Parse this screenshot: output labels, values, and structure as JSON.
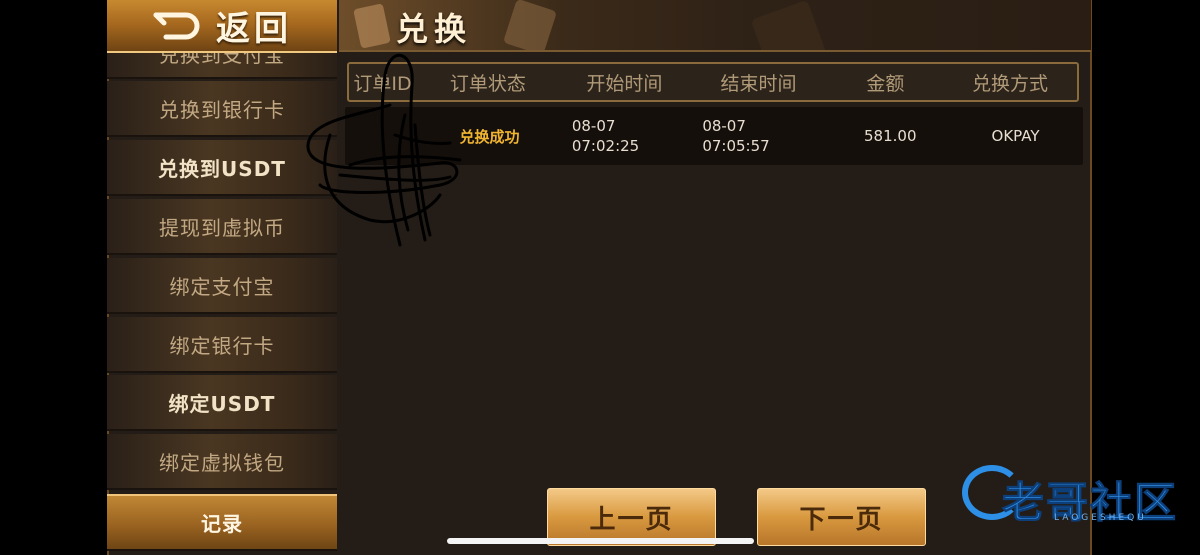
{
  "header": {
    "back_label": "返回",
    "title": "兑换"
  },
  "sidebar": {
    "items": [
      {
        "label": "兑换到支付宝"
      },
      {
        "label": "兑换到银行卡"
      },
      {
        "label": "兑换到USDT"
      },
      {
        "label": "提现到虚拟币"
      },
      {
        "label": "绑定支付宝"
      },
      {
        "label": "绑定银行卡"
      },
      {
        "label": "绑定USDT"
      },
      {
        "label": "绑定虚拟钱包"
      },
      {
        "label": "记录"
      }
    ]
  },
  "table": {
    "headers": [
      "订单ID",
      "订单状态",
      "开始时间",
      "结束时间",
      "金额",
      "兑换方式"
    ],
    "rows": [
      {
        "order_id": "",
        "status": "兑换成功",
        "start_date": "08-07",
        "start_time": "07:02:25",
        "end_date": "08-07",
        "end_time": "07:05:57",
        "amount": "581.00",
        "method": "OKPAY"
      }
    ]
  },
  "pagination": {
    "prev_label": "上一页",
    "next_label": "下一页"
  },
  "watermark": {
    "text": "老哥社区",
    "sub": "LAOGESHEQU"
  },
  "colors": {
    "status_success": "#f0b431",
    "accent_gold": "#d9993f",
    "watermark_blue": "#2f8ce2"
  }
}
